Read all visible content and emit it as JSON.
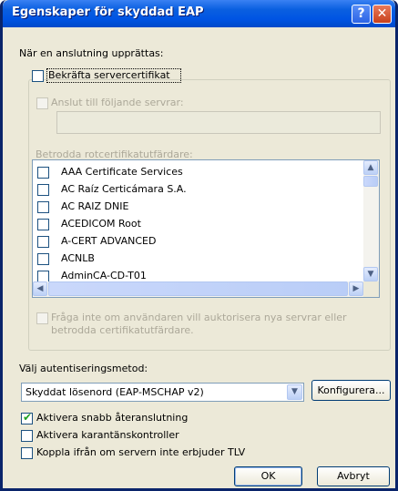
{
  "window": {
    "title": "Egenskaper för skyddad EAP",
    "help_glyph": "?",
    "close_glyph": "✕"
  },
  "connect_label": "När en anslutning upprättas:",
  "verify_cert": {
    "label": "Bekräfta servercertifikat",
    "checked": false
  },
  "connect_servers": {
    "label": "Anslut till följande servrar:",
    "checked": false,
    "enabled": false,
    "value": ""
  },
  "trusted_ca_label": "Betrodda rotcertifikatutfärdare:",
  "ca_list": [
    {
      "label": "AAA Certificate Services",
      "checked": false
    },
    {
      "label": "AC Raíz Certicámara S.A.",
      "checked": false
    },
    {
      "label": "AC RAIZ DNIE",
      "checked": false
    },
    {
      "label": "ACEDICOM Root",
      "checked": false
    },
    {
      "label": "A-CERT ADVANCED",
      "checked": false
    },
    {
      "label": "ACNLB",
      "checked": false
    },
    {
      "label": "AdminCA-CD-T01",
      "checked": false
    }
  ],
  "no_prompt": {
    "label_line1": "Fråga inte om användaren vill auktorisera nya servrar eller",
    "label_line2": "betrodda certifikatutfärdare.",
    "checked": false,
    "enabled": false
  },
  "auth_method_label": "Välj autentiseringsmetod:",
  "auth_method": {
    "selected": "Skyddat lösenord (EAP-MSCHAP v2)"
  },
  "configure_button": "Konfigurera...",
  "fast_reconnect": {
    "label": "Aktivera snabb återanslutning",
    "checked": true
  },
  "quarantine": {
    "label": "Aktivera karantänskontroller",
    "checked": false
  },
  "disconnect_tlv": {
    "label": "Koppla ifrån om servern inte erbjuder TLV",
    "checked": false
  },
  "ok_button": "OK",
  "cancel_button": "Avbryt",
  "scroll_glyphs": {
    "up": "▲",
    "down": "▼",
    "left": "◀",
    "right": "▶",
    "dropdown": "▼",
    "check": "✔"
  },
  "colors": {
    "titlebar": "#0054e3",
    "dialog_bg": "#ece9d8",
    "check": "#21a121"
  }
}
